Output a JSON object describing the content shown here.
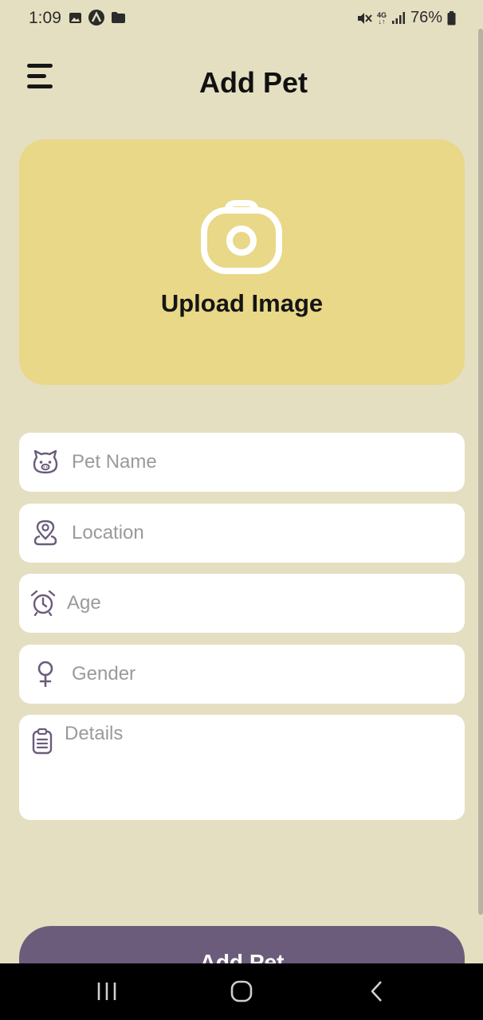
{
  "status_bar": {
    "time": "1:09",
    "network": "4G",
    "battery": "76%",
    "left_icons": [
      "gallery-icon",
      "app-notification-icon",
      "folder-icon"
    ],
    "right_icons": [
      "mute-icon",
      "network-icon",
      "signal-icon",
      "battery-icon"
    ]
  },
  "header": {
    "title": "Add Pet",
    "menu_icon": "hamburger-menu-icon"
  },
  "upload": {
    "label": "Upload Image",
    "icon": "camera-icon"
  },
  "form": {
    "pet_name": {
      "placeholder": "Pet Name",
      "value": "",
      "icon": "pet-face-icon"
    },
    "location": {
      "placeholder": "Location",
      "value": "",
      "icon": "location-pin-icon"
    },
    "age": {
      "placeholder": "Age",
      "value": "",
      "icon": "alarm-clock-icon"
    },
    "gender": {
      "placeholder": "Gender",
      "value": "",
      "icon": "female-symbol-icon"
    },
    "details": {
      "placeholder": "Details",
      "value": "",
      "icon": "clipboard-icon"
    }
  },
  "submit": {
    "label": "Add Pet"
  },
  "nav": {
    "icons": [
      "recent-apps-icon",
      "home-icon",
      "back-icon"
    ]
  },
  "colors": {
    "background": "#e5dfc1",
    "upload_card": "#e8d887",
    "button": "#6b5c7b",
    "icon": "#6b5c7b"
  }
}
